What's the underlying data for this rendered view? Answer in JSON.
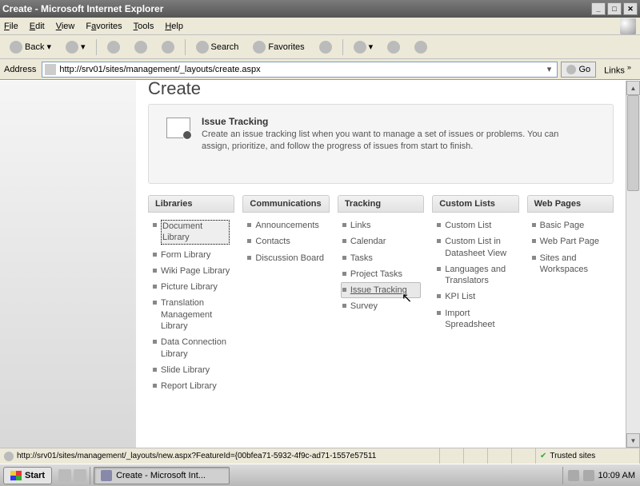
{
  "window": {
    "title": "Create - Microsoft Internet Explorer"
  },
  "menus": {
    "file": "File",
    "edit": "Edit",
    "view": "View",
    "favorites": "Favorites",
    "tools": "Tools",
    "help": "Help"
  },
  "toolbar": {
    "back": "Back",
    "search": "Search",
    "favorites": "Favorites"
  },
  "address": {
    "label": "Address",
    "url": "http://srv01/sites/management/_layouts/create.aspx",
    "go": "Go",
    "links": "Links"
  },
  "page": {
    "title": "Create"
  },
  "hero": {
    "heading": "Issue Tracking",
    "body": "Create an issue tracking list when you want to manage a set of issues or problems. You can assign, prioritize, and follow the progress of issues from start to finish."
  },
  "columns": {
    "libraries": {
      "head": "Libraries",
      "items": [
        "Document Library",
        "Form Library",
        "Wiki Page Library",
        "Picture Library",
        "Translation Management Library",
        "Data Connection Library",
        "Slide Library",
        "Report Library"
      ]
    },
    "communications": {
      "head": "Communications",
      "items": [
        "Announcements",
        "Contacts",
        "Discussion Board"
      ]
    },
    "tracking": {
      "head": "Tracking",
      "items": [
        "Links",
        "Calendar",
        "Tasks",
        "Project Tasks",
        "Issue Tracking",
        "Survey"
      ]
    },
    "custom": {
      "head": "Custom Lists",
      "items": [
        "Custom List",
        "Custom List in Datasheet View",
        "Languages and Translators",
        "KPI List",
        "Import Spreadsheet"
      ]
    },
    "web": {
      "head": "Web Pages",
      "items": [
        "Basic Page",
        "Web Part Page",
        "Sites and Workspaces"
      ]
    }
  },
  "status": {
    "url": "http://srv01/sites/management/_layouts/new.aspx?FeatureId={00bfea71-5932-4f9c-ad71-1557e57511",
    "zone": "Trusted sites"
  },
  "taskbar": {
    "start": "Start",
    "task1": "Create - Microsoft Int...",
    "clock": "10:09 AM"
  }
}
